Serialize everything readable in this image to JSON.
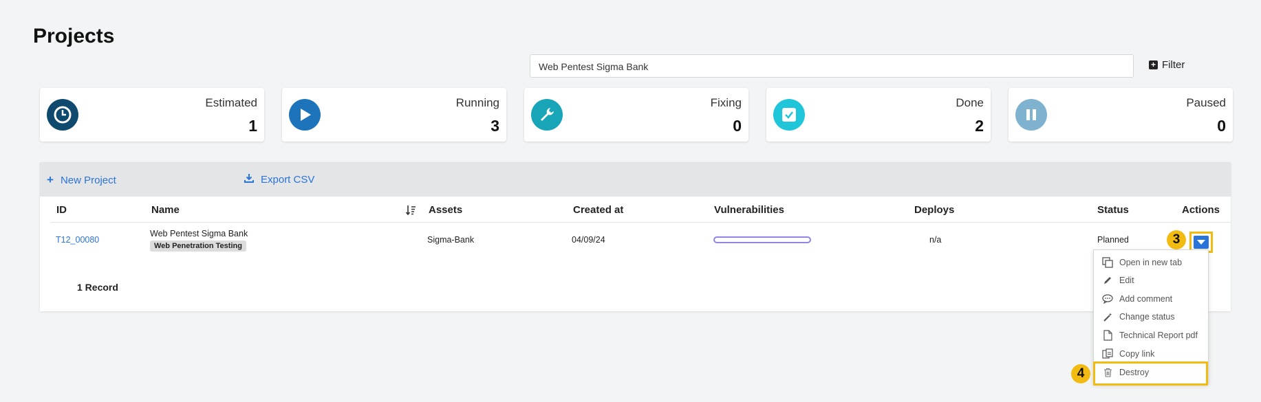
{
  "page": {
    "title": "Projects"
  },
  "search": {
    "value": "Web Pentest Sigma Bank"
  },
  "filter": {
    "label": "Filter"
  },
  "cards": [
    {
      "label": "Estimated",
      "value": "1",
      "color": "#0f4a6e",
      "icon": "clock-icon"
    },
    {
      "label": "Running",
      "value": "3",
      "color": "#1e74bb",
      "icon": "play-icon"
    },
    {
      "label": "Fixing",
      "value": "0",
      "color": "#17a5b7",
      "icon": "wrench-icon"
    },
    {
      "label": "Done",
      "value": "2",
      "color": "#1fc6d9",
      "icon": "check-square-icon"
    },
    {
      "label": "Paused",
      "value": "0",
      "color": "#7fb2cf",
      "icon": "pause-icon"
    }
  ],
  "toolbar": {
    "new_project": "New Project",
    "export_csv": "Export CSV"
  },
  "table": {
    "headers": [
      "ID",
      "Name",
      "Assets",
      "Created at",
      "Vulnerabilities",
      "Deploys",
      "Status",
      "Actions"
    ],
    "rows": [
      {
        "id": "T12_00080",
        "name": "Web Pentest Sigma Bank",
        "tag": "Web Penetration Testing",
        "assets": "Sigma-Bank",
        "created_at": "04/09/24",
        "deploys": "n/a",
        "status": "Planned"
      }
    ],
    "record_count": "1 Record"
  },
  "actions_menu": {
    "items": [
      {
        "label": "Open in new tab",
        "icon": "copy-icon"
      },
      {
        "label": "Edit",
        "icon": "pencil-icon"
      },
      {
        "label": "Add comment",
        "icon": "comment-icon"
      },
      {
        "label": "Change status",
        "icon": "magic-wand-icon"
      },
      {
        "label": "Technical Report pdf",
        "icon": "file-icon"
      },
      {
        "label": "Copy link",
        "icon": "link-copy-icon"
      },
      {
        "label": "Destroy",
        "icon": "trash-icon"
      }
    ]
  },
  "annotations": {
    "step3": "3",
    "step4": "4"
  },
  "colors": {
    "accent": "#2a73d9",
    "highlight": "#f2bb12",
    "vuln_bar": "#8d85e8"
  }
}
